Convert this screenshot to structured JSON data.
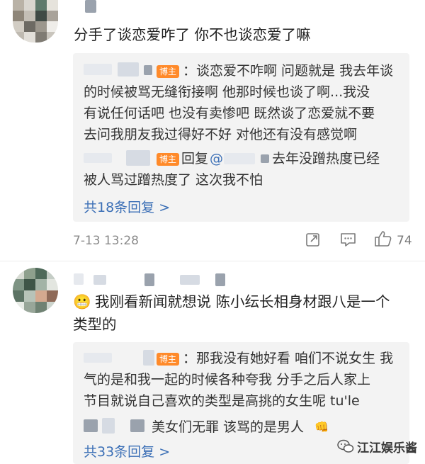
{
  "comment1": {
    "text": "分手了谈恋爱咋了 你不也谈恋爱了嘛",
    "reply1": {
      "badge": "博主",
      "text_line1": "：谈恋爱不咋啊 问题就是 我去年谈",
      "text_line2": "的时候被骂无缝衔接啊 他那时候也谈了啊...我没",
      "text_line3": "有说任何话吧 也没有卖惨吧 既然谈了恋爱就不要",
      "text_line4": "去问我朋友我过得好不好 对他还有没有感觉啊"
    },
    "reply2": {
      "badge": "博主",
      "reply_word": "回复",
      "at": "@",
      "text_line1": "去年没蹭热度已经",
      "text_line2": "被人骂过蹭热度了 这次我不怕"
    },
    "more_replies": "共18条回复 >",
    "time": "7-13 13:28",
    "likes": "74"
  },
  "comment2": {
    "emoji": "😬",
    "text_line1": "我刚看新闻就想说 陈小纭长相身材跟八是一个",
    "text_line2": "类型的",
    "reply1": {
      "badge": "博主",
      "text_line1": "：那我没有她好看 咱们不说女生 我",
      "text_line2": "气的是和我一起的时候各种夸我 分手之后人家上",
      "text_line3": "节目就说自己喜欢的类型是高挑的女生呢  tu'le"
    },
    "reply2": {
      "text": "美女们无罪 该骂的是男人",
      "emoji": "👊"
    },
    "more_replies": "共33条回复 >"
  },
  "watermark": {
    "text": "江江娱乐酱"
  },
  "colors": {
    "link": "#3b6fb6",
    "badge": "#ff8a2a",
    "reply_bg": "#f3f3f3",
    "meta": "#8a8a8a"
  },
  "icons": [
    "share-icon",
    "comment-icon",
    "like-icon",
    "wechat-icon"
  ]
}
